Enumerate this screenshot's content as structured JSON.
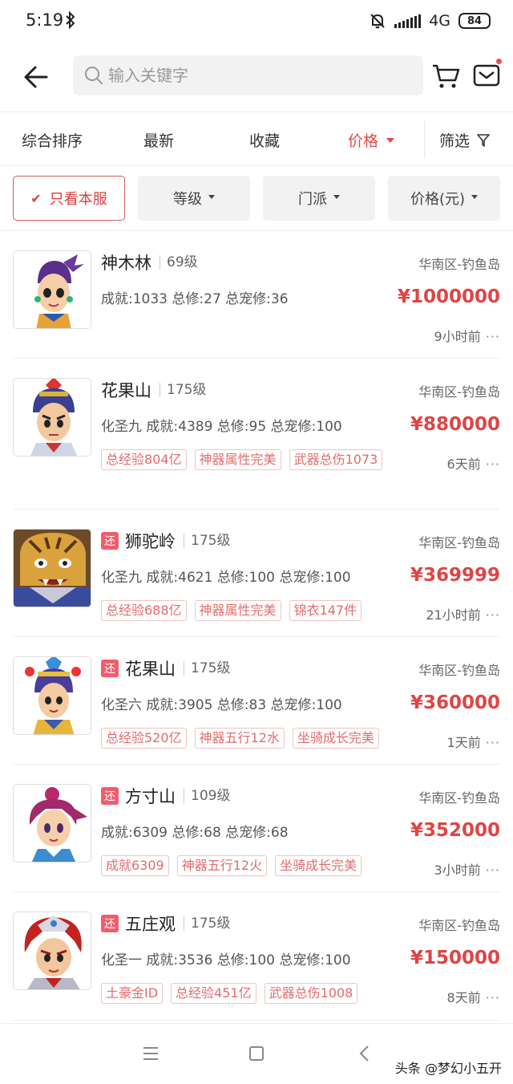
{
  "status_bar": {
    "time": "5:19",
    "network": "4G",
    "battery": "84"
  },
  "search": {
    "placeholder": "输入关键字"
  },
  "sort": {
    "items": [
      "综合排序",
      "最新",
      "收藏",
      "价格"
    ],
    "filter_label": "筛选"
  },
  "chips": {
    "only_this_server": "只看本服",
    "level": "等级",
    "school": "门派",
    "price_yuan": "价格(元)"
  },
  "listings": [
    {
      "server": "神木林",
      "level": "69级",
      "region": "华南区-钓鱼岛",
      "stats": "成就:1033 总修:27 总宠修:36",
      "price": "¥1000000",
      "tags": [],
      "time": "9小时前",
      "returnable": false
    },
    {
      "server": "花果山",
      "level": "175级",
      "region": "华南区-钓鱼岛",
      "stats": "化圣九 成就:4389 总修:95 总宠修:100",
      "price": "¥880000",
      "tags": [
        "总经验804亿",
        "神器属性完美",
        "武器总伤1073"
      ],
      "time": "6天前",
      "returnable": false
    },
    {
      "server": "狮驼岭",
      "level": "175级",
      "region": "华南区-钓鱼岛",
      "stats": "化圣九 成就:4621 总修:100 总宠修:100",
      "price": "¥369999",
      "tags": [
        "总经验688亿",
        "神器属性完美",
        "锦衣147件"
      ],
      "time": "21小时前",
      "returnable": true
    },
    {
      "server": "花果山",
      "level": "175级",
      "region": "华南区-钓鱼岛",
      "stats": "化圣六 成就:3905 总修:83 总宠修:100",
      "price": "¥360000",
      "tags": [
        "总经验520亿",
        "神器五行12水",
        "坐骑成长完美"
      ],
      "time": "1天前",
      "returnable": true
    },
    {
      "server": "方寸山",
      "level": "109级",
      "region": "华南区-钓鱼岛",
      "stats": "成就:6309 总修:68 总宠修:68",
      "price": "¥352000",
      "tags": [
        "成就6309",
        "神器五行12火",
        "坐骑成长完美"
      ],
      "time": "3小时前",
      "returnable": true
    },
    {
      "server": "五庄观",
      "level": "175级",
      "region": "华南区-钓鱼岛",
      "stats": "化圣一 成就:3536 总修:100 总宠修:100",
      "price": "¥150000",
      "tags": [
        "土豪金ID",
        "总经验451亿",
        "武器总伤1008"
      ],
      "time": "8天前",
      "returnable": true
    }
  ],
  "return_badge": "还",
  "more": "···",
  "watermark": "头条 @梦幻小五开",
  "colors": {
    "accent": "#de4545",
    "tag_text": "#e46b6b",
    "return_badge": "#ef5e6a"
  }
}
